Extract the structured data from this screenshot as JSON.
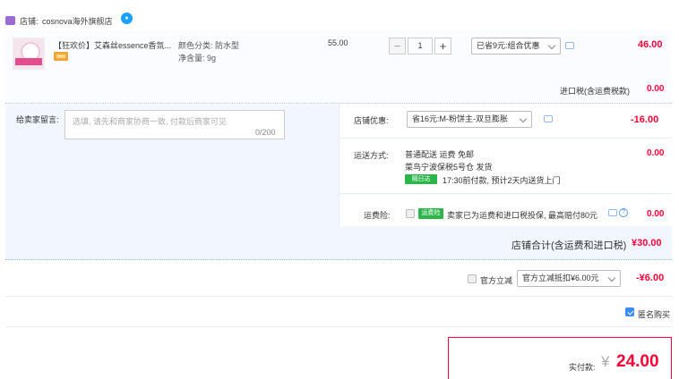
{
  "shop": {
    "label": "店铺:",
    "name": "cosnova海外旗舰店",
    "chat_icon": "wangwang-chat-icon"
  },
  "item": {
    "title": "【狂欢价】艾森丝essence香氛...",
    "sku_color": "颜色分类: 防水型",
    "sku_weight": "净含量: 9g",
    "unit_price": "55.00",
    "qty_minus": "−",
    "qty": "1",
    "qty_plus": "+",
    "promo_select": "已省9元:组合优惠",
    "total": "46.00"
  },
  "tax": {
    "label": "进口税(含运费税款)",
    "value": "0.00"
  },
  "message": {
    "label": "给卖家留言:",
    "placeholder": "选填, 请先和商家协商一致, 付款后商家可见",
    "count": "0/200"
  },
  "coupon": {
    "label": "店铺优惠:",
    "select": "省16元:M-粉饼主-双旦膨胀",
    "value": "-16.00"
  },
  "shipping": {
    "label": "运送方式:",
    "method": "普通配送 运费 免邮",
    "warehouse": "菜鸟宁波保税5号仓  发货",
    "tag": "隔日达",
    "note": "17:30前付款, 预计2天内送货上门",
    "value": "0.00"
  },
  "insurance": {
    "label": "运费险:",
    "tag": "运费险",
    "text": "卖家已为运费和进口税投保, 最高赔付80元",
    "value": "0.00"
  },
  "shop_total": {
    "label": "店铺合计(含运费和进口税)",
    "value": "¥30.00"
  },
  "gov_discount": {
    "label": "官方立减",
    "select": "官方立减抵扣¥6.00元",
    "value": "-¥6.00"
  },
  "anonymous": {
    "label": "匿名购买",
    "checked": true
  },
  "payment": {
    "label": "实付款:",
    "currency": "¥",
    "value": "24.00"
  },
  "colors": {
    "accent_red": "#ff0036",
    "link_blue": "#3b8cf5",
    "panel_blue": "#f2f7ff",
    "green_tag": "#2cb64a"
  }
}
